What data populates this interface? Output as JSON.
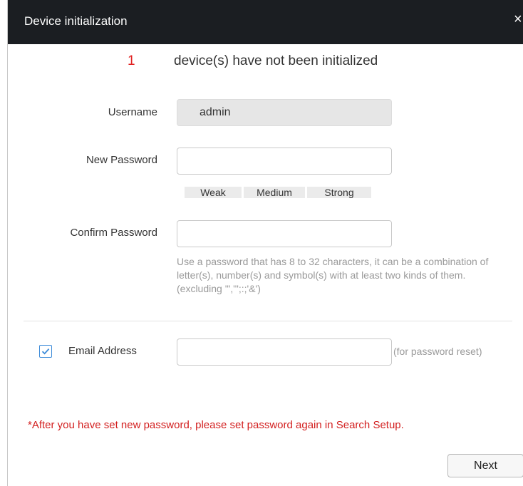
{
  "window": {
    "title": "Device initialization",
    "close_glyph": "×"
  },
  "status": {
    "count": "1",
    "message": "device(s) have not been initialized"
  },
  "form": {
    "username_label": "Username",
    "username_value": "admin",
    "new_password_label": "New Password",
    "new_password_value": "",
    "strength": [
      "Weak",
      "Medium",
      "Strong"
    ],
    "confirm_password_label": "Confirm Password",
    "confirm_password_value": "",
    "password_hint": "Use a password that has 8 to 32 characters, it can be a combination of letter(s), number(s) and symbol(s) with at least two kinds of them. (excluding '\",\"';:;'&')",
    "email_checked": true,
    "email_label": "Email Address",
    "email_value": "",
    "email_hint": "(for password reset)"
  },
  "warning": "*After you have set new password, please set password again in Search Setup.",
  "buttons": {
    "next": "Next"
  },
  "colors": {
    "titlebar": "#1b1e22",
    "accent": "#3c8bd9",
    "warning": "#d32020"
  }
}
